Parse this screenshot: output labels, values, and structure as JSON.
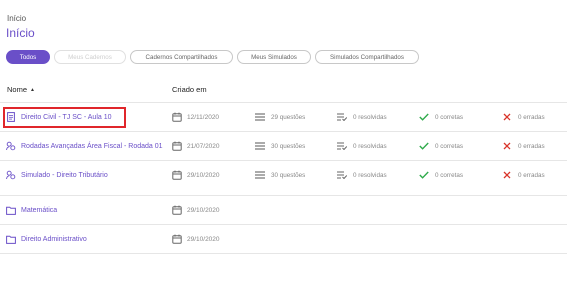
{
  "breadcrumb": "Início",
  "title": "Início",
  "filters": [
    {
      "label": "Todos",
      "state": "active"
    },
    {
      "label": "Meus Cadernos",
      "state": "disabled"
    },
    {
      "label": "Cadernos Compartilhados",
      "state": "normal"
    },
    {
      "label": "Meus Simulados",
      "state": "normal"
    },
    {
      "label": "Simulados Compartilhados",
      "state": "normal"
    }
  ],
  "columns": {
    "name": "Nome",
    "created": "Criado em"
  },
  "rows": [
    {
      "icon": "document-icon",
      "name": "Direito Civil - TJ SC - Aula 10",
      "date": "12/11/2020",
      "questions": "29 questões",
      "resolved": "0 resolvidas",
      "correct": "0 corretas",
      "wrong": "0 erradas"
    },
    {
      "icon": "shared-quiz-icon",
      "name": "Rodadas Avançadas Área Fiscal - Rodada 01",
      "date": "21/07/2020",
      "questions": "30 questões",
      "resolved": "0 resolvidas",
      "correct": "0 corretas",
      "wrong": "0 erradas"
    },
    {
      "icon": "shared-quiz-icon",
      "name": "Simulado - Direito Tributário",
      "date": "29/10/2020",
      "questions": "30 questões",
      "resolved": "0 resolvidas",
      "correct": "0 corretas",
      "wrong": "0 erradas"
    },
    {
      "icon": "folder-icon",
      "name": "Matemática",
      "date": "29/10/2020"
    },
    {
      "icon": "folder-icon",
      "name": "Direito Administrativo",
      "date": "29/10/2020"
    }
  ],
  "colors": {
    "accent": "#6a4fc8",
    "highlight": "#e0262b",
    "correct": "#2eaa4a",
    "wrong": "#d9352b"
  }
}
